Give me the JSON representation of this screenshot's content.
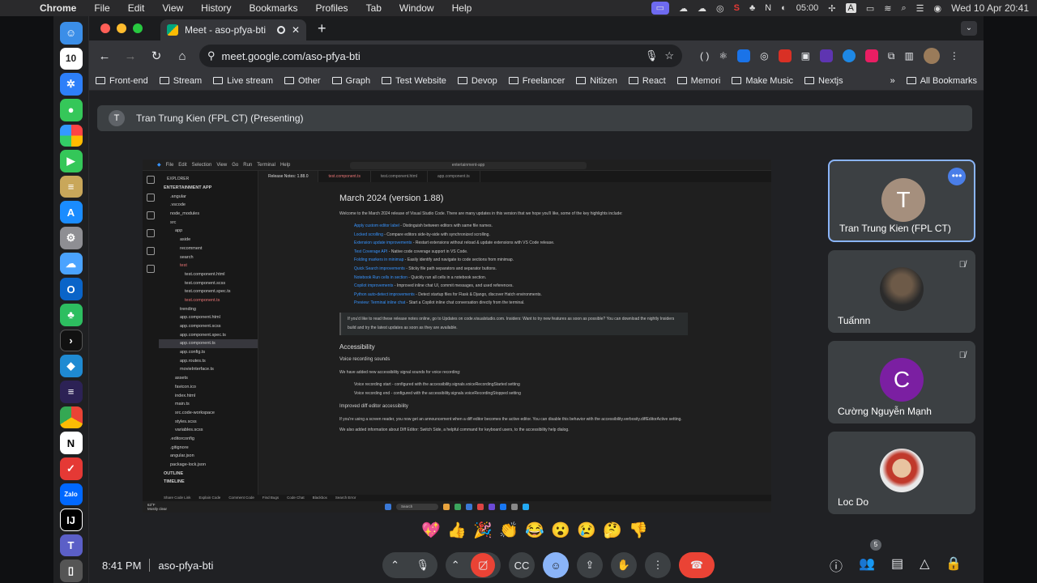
{
  "macos": {
    "app_name": "Chrome",
    "menus": [
      "File",
      "Edit",
      "View",
      "History",
      "Bookmarks",
      "Profiles",
      "Tab",
      "Window",
      "Help"
    ],
    "clock": "05:00",
    "input_source": "A",
    "datetime": "Wed 10 Apr  20:41"
  },
  "dock": {
    "items": [
      "finder",
      "calendar",
      "safari",
      "messages",
      "photos",
      "facetime",
      "notes",
      "app-store",
      "settings",
      "weather",
      "outlook",
      "evernote",
      "terminal",
      "vscode",
      "eclipse",
      "chrome",
      "notion",
      "fantastical",
      "zalo",
      "intellij",
      "teams",
      "trash"
    ],
    "calendar_day": "10",
    "zalo_label": "Zalo"
  },
  "browser": {
    "tab_title": "Meet - aso-pfya-bti",
    "new_tab": "+",
    "url": "meet.google.com/aso-pfya-bti",
    "bookmarks": [
      "Front-end",
      "Stream",
      "Live stream",
      "Other",
      "Graph",
      "Test Website",
      "Devop",
      "Freelancer",
      "Nitizen",
      "React",
      "Memori",
      "Make Music",
      "Nextjs"
    ],
    "all_bookmarks": "All Bookmarks",
    "more": "»"
  },
  "meet": {
    "presenter_initial": "T",
    "presenter_label": "Tran Trung Kien (FPL CT) (Presenting)",
    "participants": [
      {
        "name": "Tran Trung Kien (FPL CT)",
        "initial": "T",
        "color": "#a58f7d"
      },
      {
        "name": "Tuấnnn",
        "initial": "",
        "color": "#2b2b2b"
      },
      {
        "name": "Cường Nguyễn Mạnh",
        "initial": "C",
        "color": "#7b1fa2"
      },
      {
        "name": "Loc Do",
        "initial": "",
        "color": "#e9e9e9"
      }
    ],
    "reactions": [
      "💖",
      "👍",
      "🎉",
      "👏",
      "😂",
      "😮",
      "😢",
      "🤔",
      "👎"
    ],
    "time": "8:41 PM",
    "meeting_code": "aso-pfya-bti",
    "people_count": "5"
  },
  "shared_screen": {
    "vscode_menus": [
      "File",
      "Edit",
      "Selection",
      "View",
      "Go",
      "Run",
      "Terminal",
      "Help"
    ],
    "command_center": "entertainment-app",
    "explorer_header": "EXPLORER",
    "project": "ENTERTAINMENT APP",
    "tree": [
      ".angular",
      ".vscode",
      "node_modules",
      "src",
      "app",
      "aside",
      "recomment",
      "search",
      "test",
      "test.component.html",
      "test.component.scss",
      "test.component.spec.ts",
      "test.component.ts",
      "trending",
      "app.component.html",
      "app.component.scss",
      "app.component.spec.ts",
      "app.component.ts",
      "app.config.ts",
      "app.routes.ts",
      "movieInterface.ts",
      "assets",
      "favicon.ico",
      "index.html",
      "main.ts",
      "src.code-workspace",
      "styles.scss",
      "variables.scss",
      ".editorconfig",
      ".gitignore",
      "angular.json",
      "package-lock.json"
    ],
    "outline": "OUTLINE",
    "timeline": "TIMELINE",
    "editor_tabs": [
      "Release Notes: 1.88.0",
      "test.component.ts",
      "test.component.html",
      "app.component.ts"
    ],
    "doc_title": "March 2024 (version 1.88)",
    "intro": "Welcome to the March 2024 release of Visual Studio Code. There are many updates in this version that we hope you'll like, some of the key highlights include:",
    "highlights": [
      {
        "link": "Apply custom editor label",
        "text": " - Distinguish between editors with same file names."
      },
      {
        "link": "Locked scrolling",
        "text": " - Compare editors side-by-side with synchronized scrolling."
      },
      {
        "link": "Extension update improvements",
        "text": " - Restart extensions without reload & update extensions with VS Code release."
      },
      {
        "link": "Test Coverage API",
        "text": " - Native code coverage support in VS Code."
      },
      {
        "link": "Folding markers in minimap",
        "text": " - Easily identify and navigate to code sections from minimap."
      },
      {
        "link": "Quick Search improvements",
        "text": " - Sticky file path separators and separator buttons."
      },
      {
        "link": "Notebook Run cells in section",
        "text": " - Quickly run all cells in a notebook section."
      },
      {
        "link": "Copilot improvements",
        "text": " - Improved inline chat UI, commit messages, and used references."
      },
      {
        "link": "Python auto-detect improvements",
        "text": " - Detect startup files for Flask & Django, discover Hatch environments."
      },
      {
        "link": "Preview: Terminal inline chat",
        "text": " - Start a Copilot inline chat conversation directly from the terminal."
      }
    ],
    "note": "If you'd like to read these release notes online, go to Updates on code.visualstudio.com. Insiders: Want to try new features as soon as possible? You can download the nightly Insiders build and try the latest updates as soon as they are available.",
    "h_accessibility": "Accessibility",
    "h_voice": "Voice recording sounds",
    "voice_para": "We have added new accessibility signal sounds for voice recording:",
    "voice_items": [
      "Voice recording start - configured with the accessibility.signals.voiceRecordingStarted setting",
      "Voice recording end - configured with the accessibility.signals.voiceRecordingStopped setting"
    ],
    "h_diff": "Improved diff editor accessibility",
    "diff_para": "If you're using a screen reader, you now get an announcement when a diff editor becomes the active editor. You can disable this behavior with the accessibility.verbosity.diffEditorActive setting.",
    "diff_para2": "We also added information about Diff Editor: Switch Side, a helpful command for keyboard users, to the accessibility help dialog.",
    "status_items": [
      "Share Code Link",
      "Explain Code",
      "Comment Code",
      "Find Bugs",
      "Code Chat",
      "Blackbox",
      "Search Error"
    ],
    "weather_temp": "63°F",
    "weather_desc": "Mostly clear",
    "taskbar_search": "Search"
  }
}
